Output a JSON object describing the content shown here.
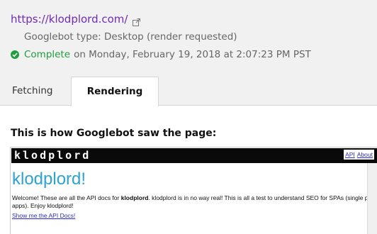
{
  "header": {
    "url": "https://klodplord.com/",
    "googlebot_type": "Googlebot type: Desktop (render requested)",
    "status_word": "Complete",
    "status_time": "on Monday, February 19, 2018 at 2:07:23 PM PST",
    "status_color": "#1e9e3e",
    "link_color": "#6f2bb6"
  },
  "tabs": [
    {
      "label": "Fetching",
      "active": false
    },
    {
      "label": "Rendering",
      "active": true
    }
  ],
  "main": {
    "heading": "This is how Googlebot saw the page:"
  },
  "rendered_page": {
    "logo": "klodplord",
    "nav": [
      "API",
      "About"
    ],
    "title": "klodplord!",
    "desc_before": "Welcome! These are all the API docs for ",
    "desc_bold": "klodplord",
    "desc_after": ". klodplord is in no way real! This is all a test to understand SEO for SPAs (single page apps). Enjoy klodplord!",
    "link": "Show me the API Docs!",
    "title_color": "#2ba3d6"
  },
  "icons": {
    "external": "external-link-icon",
    "status": "check-circle-icon"
  }
}
